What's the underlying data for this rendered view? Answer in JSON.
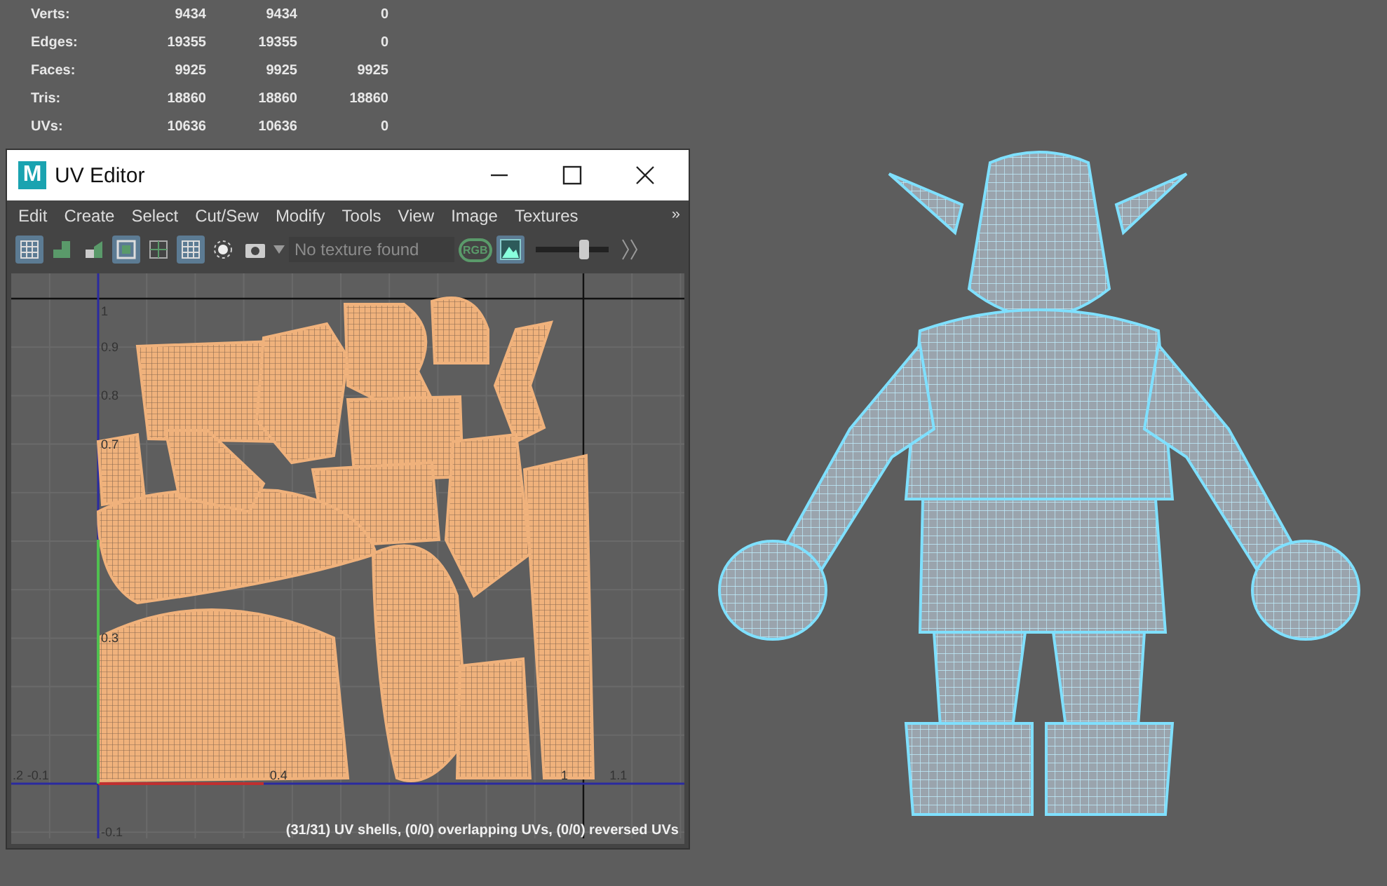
{
  "stats": {
    "rows": [
      {
        "label": "Verts:",
        "values": [
          "9434",
          "9434",
          "0"
        ]
      },
      {
        "label": "Edges:",
        "values": [
          "19355",
          "19355",
          "0"
        ]
      },
      {
        "label": "Faces:",
        "values": [
          "9925",
          "9925",
          "9925"
        ]
      },
      {
        "label": "Tris:",
        "values": [
          "18860",
          "18860",
          "18860"
        ]
      },
      {
        "label": "UVs:",
        "values": [
          "10636",
          "10636",
          "0"
        ]
      }
    ]
  },
  "window": {
    "title": "UV Editor",
    "logo": "M"
  },
  "menu": {
    "items": [
      "Edit",
      "Create",
      "Select",
      "Cut/Sew",
      "Modify",
      "Tools",
      "View",
      "Image",
      "Textures"
    ],
    "overflow": "»"
  },
  "toolbar": {
    "buttons": [
      {
        "kind": "grid",
        "selected": true
      },
      {
        "kind": "shell",
        "selected": false
      },
      {
        "kind": "shell2",
        "selected": false
      },
      {
        "kind": "frame",
        "selected": true
      },
      {
        "kind": "frame2",
        "selected": false
      },
      {
        "kind": "grid",
        "selected": true
      },
      {
        "kind": "dots",
        "selected": false
      },
      {
        "kind": "camera",
        "selected": false
      }
    ],
    "texture_field": {
      "placeholder": "No texture found"
    },
    "rgb_label": "RGB",
    "image_toggle": {
      "selected": true
    },
    "slider": {
      "level": 0.6
    }
  },
  "viewport": {
    "y_labels": [
      "1",
      "0.9",
      "0.8",
      "0.7",
      "0.3",
      "-0.1"
    ],
    "x_labels": [
      ".2",
      "-0.1",
      "0.4",
      "1",
      "1.1"
    ],
    "status": "(31/31) UV shells, (0/0) overlapping UVs, (0/0) reversed UVs"
  }
}
